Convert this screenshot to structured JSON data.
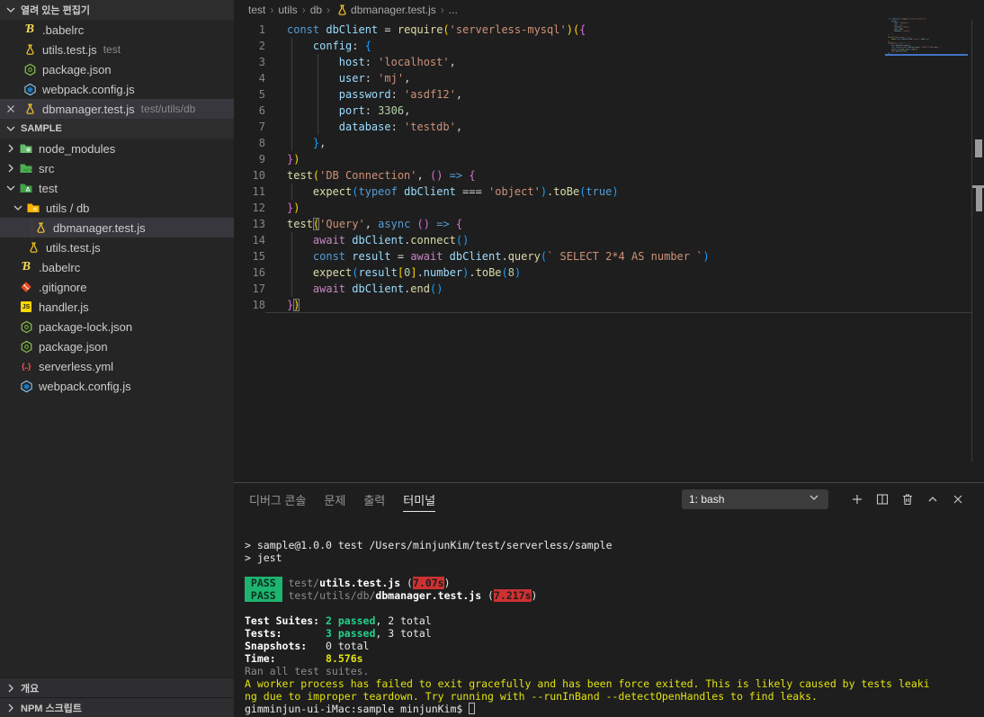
{
  "colors": {
    "accent_blue": "#3f74c4",
    "pass_badge_bg": "#1db470",
    "pass_badge_fg": "#0e2f1f",
    "time_badge_bg": "#cd3131",
    "terminal_green": "#23d18b",
    "terminal_yellow": "#e2e210",
    "selection_bg": "#37373d"
  },
  "sidebar": {
    "open_editors": {
      "header": "열려 있는 편집기",
      "items": [
        {
          "icon": "babel",
          "name": ".babelrc"
        },
        {
          "icon": "test-flask",
          "name": "utils.test.js",
          "detail": "test"
        },
        {
          "icon": "npm",
          "name": "package.json"
        },
        {
          "icon": "webpack",
          "name": "webpack.config.js"
        },
        {
          "icon": "test-flask",
          "name": "dbmanager.test.js",
          "detail": "test/utils/db",
          "selected": true,
          "close": true
        }
      ]
    },
    "explorer": {
      "header": "SAMPLE",
      "items": [
        {
          "icon": "folder-node",
          "chevron": "right",
          "name": "node_modules",
          "depth": 0
        },
        {
          "icon": "folder-src",
          "chevron": "right",
          "name": "src",
          "depth": 0
        },
        {
          "icon": "folder-test",
          "chevron": "down",
          "name": "test",
          "depth": 0
        },
        {
          "icon": "folder-utils",
          "chevron": "down",
          "name": "utils / db",
          "depth": 1
        },
        {
          "icon": "test-flask",
          "name": "dbmanager.test.js",
          "depth": 2,
          "selected": true,
          "guide": true
        },
        {
          "icon": "test-flask",
          "name": "utils.test.js",
          "depth": 1
        },
        {
          "icon": "babel",
          "name": ".babelrc",
          "depth": 0
        },
        {
          "icon": "git",
          "name": ".gitignore",
          "depth": 0
        },
        {
          "icon": "js",
          "name": "handler.js",
          "depth": 0
        },
        {
          "icon": "npm",
          "name": "package-lock.json",
          "depth": 0
        },
        {
          "icon": "npm",
          "name": "package.json",
          "depth": 0
        },
        {
          "icon": "serverless",
          "name": "serverless.yml",
          "depth": 0
        },
        {
          "icon": "webpack",
          "name": "webpack.config.js",
          "depth": 0
        }
      ]
    },
    "outline_header": "개요",
    "npm_scripts_header": "NPM 스크립트"
  },
  "editor": {
    "breadcrumb": [
      {
        "label": "test"
      },
      {
        "label": "utils"
      },
      {
        "label": "db"
      },
      {
        "label": "dbmanager.test.js",
        "icon": "test-flask"
      },
      {
        "label": "..."
      }
    ],
    "code_lines": [
      {
        "num": "1",
        "guides": [],
        "tokens": [
          [
            "kw",
            "const"
          ],
          [
            "pun",
            " "
          ],
          [
            "var",
            "dbClient"
          ],
          [
            "pun",
            " = "
          ],
          [
            "fn",
            "require"
          ],
          [
            "b1",
            "("
          ],
          [
            "str",
            "'serverless-mysql'"
          ],
          [
            "b1",
            ")"
          ],
          [
            "b1",
            "("
          ],
          [
            "b2",
            "{"
          ]
        ]
      },
      {
        "num": "2",
        "guides": [
          0
        ],
        "tokens": [
          [
            "pun",
            "    "
          ],
          [
            "var",
            "config"
          ],
          [
            "pun",
            ": "
          ],
          [
            "b3",
            "{"
          ]
        ]
      },
      {
        "num": "3",
        "guides": [
          0,
          1
        ],
        "tokens": [
          [
            "pun",
            "        "
          ],
          [
            "var",
            "host"
          ],
          [
            "pun",
            ": "
          ],
          [
            "str",
            "'localhost'"
          ],
          [
            "pun",
            ","
          ]
        ]
      },
      {
        "num": "4",
        "guides": [
          0,
          1
        ],
        "tokens": [
          [
            "pun",
            "        "
          ],
          [
            "var",
            "user"
          ],
          [
            "pun",
            ": "
          ],
          [
            "str",
            "'mj'"
          ],
          [
            "pun",
            ","
          ]
        ]
      },
      {
        "num": "5",
        "guides": [
          0,
          1
        ],
        "tokens": [
          [
            "pun",
            "        "
          ],
          [
            "var",
            "password"
          ],
          [
            "pun",
            ": "
          ],
          [
            "str",
            "'asdf12'"
          ],
          [
            "pun",
            ","
          ]
        ]
      },
      {
        "num": "6",
        "guides": [
          0,
          1
        ],
        "tokens": [
          [
            "pun",
            "        "
          ],
          [
            "var",
            "port"
          ],
          [
            "pun",
            ": "
          ],
          [
            "num",
            "3306"
          ],
          [
            "pun",
            ","
          ]
        ]
      },
      {
        "num": "7",
        "guides": [
          0,
          1
        ],
        "tokens": [
          [
            "pun",
            "        "
          ],
          [
            "var",
            "database"
          ],
          [
            "pun",
            ": "
          ],
          [
            "str",
            "'testdb'"
          ],
          [
            "pun",
            ","
          ]
        ]
      },
      {
        "num": "8",
        "guides": [
          0
        ],
        "tokens": [
          [
            "pun",
            "    "
          ],
          [
            "b3",
            "}"
          ],
          [
            "pun",
            ","
          ]
        ]
      },
      {
        "num": "9",
        "guides": [],
        "tokens": [
          [
            "b2",
            "}"
          ],
          [
            "b1",
            ")"
          ]
        ]
      },
      {
        "num": "10",
        "guides": [],
        "tokens": [
          [
            "fn",
            "test"
          ],
          [
            "b1",
            "("
          ],
          [
            "str",
            "'DB Connection'"
          ],
          [
            "pun",
            ", "
          ],
          [
            "b2",
            "("
          ],
          [
            "b2",
            ")"
          ],
          [
            "pun",
            " "
          ],
          [
            "kw",
            "=>"
          ],
          [
            "pun",
            " "
          ],
          [
            "b2",
            "{"
          ]
        ]
      },
      {
        "num": "11",
        "guides": [
          0
        ],
        "tokens": [
          [
            "pun",
            "    "
          ],
          [
            "fn",
            "expect"
          ],
          [
            "b3",
            "("
          ],
          [
            "kw",
            "typeof"
          ],
          [
            "pun",
            " "
          ],
          [
            "var",
            "dbClient"
          ],
          [
            "pun",
            " === "
          ],
          [
            "str",
            "'object'"
          ],
          [
            "b3",
            ")"
          ],
          [
            "pun",
            "."
          ],
          [
            "fn",
            "toBe"
          ],
          [
            "b3",
            "("
          ],
          [
            "kw",
            "true"
          ],
          [
            "b3",
            ")"
          ]
        ]
      },
      {
        "num": "12",
        "guides": [],
        "tokens": [
          [
            "b2",
            "}"
          ],
          [
            "b1",
            ")"
          ]
        ]
      },
      {
        "num": "13",
        "guides": [],
        "tokens": [
          [
            "fn",
            "test"
          ],
          [
            "b1",
            "(",
            true
          ],
          [
            "str",
            "'Query'"
          ],
          [
            "pun",
            ", "
          ],
          [
            "kw",
            "async"
          ],
          [
            "pun",
            " "
          ],
          [
            "b2",
            "("
          ],
          [
            "b2",
            ")"
          ],
          [
            "pun",
            " "
          ],
          [
            "kw",
            "=>"
          ],
          [
            "pun",
            " "
          ],
          [
            "b2",
            "{"
          ]
        ]
      },
      {
        "num": "14",
        "guides": [
          0
        ],
        "tokens": [
          [
            "pun",
            "    "
          ],
          [
            "ctrl",
            "await"
          ],
          [
            "pun",
            " "
          ],
          [
            "var",
            "dbClient"
          ],
          [
            "pun",
            "."
          ],
          [
            "fn",
            "connect"
          ],
          [
            "b3",
            "("
          ],
          [
            "b3",
            ")"
          ]
        ]
      },
      {
        "num": "15",
        "guides": [
          0
        ],
        "tokens": [
          [
            "pun",
            "    "
          ],
          [
            "kw",
            "const"
          ],
          [
            "pun",
            " "
          ],
          [
            "var",
            "result"
          ],
          [
            "pun",
            " = "
          ],
          [
            "ctrl",
            "await"
          ],
          [
            "pun",
            " "
          ],
          [
            "var",
            "dbClient"
          ],
          [
            "pun",
            "."
          ],
          [
            "fn",
            "query"
          ],
          [
            "b3",
            "("
          ],
          [
            "str",
            "` SELECT 2*4 AS number `"
          ],
          [
            "b3",
            ")"
          ]
        ]
      },
      {
        "num": "16",
        "guides": [
          0
        ],
        "tokens": [
          [
            "pun",
            "    "
          ],
          [
            "fn",
            "expect"
          ],
          [
            "b3",
            "("
          ],
          [
            "var",
            "result"
          ],
          [
            "b1",
            "["
          ],
          [
            "num",
            "0"
          ],
          [
            "b1",
            "]"
          ],
          [
            "pun",
            "."
          ],
          [
            "var",
            "number"
          ],
          [
            "b3",
            ")"
          ],
          [
            "pun",
            "."
          ],
          [
            "fn",
            "toBe"
          ],
          [
            "b3",
            "("
          ],
          [
            "num",
            "8"
          ],
          [
            "b3",
            ")"
          ]
        ]
      },
      {
        "num": "17",
        "guides": [
          0
        ],
        "tokens": [
          [
            "pun",
            "    "
          ],
          [
            "ctrl",
            "await"
          ],
          [
            "pun",
            " "
          ],
          [
            "var",
            "dbClient"
          ],
          [
            "pun",
            "."
          ],
          [
            "fn",
            "end"
          ],
          [
            "b3",
            "("
          ],
          [
            "b3",
            ")"
          ]
        ]
      },
      {
        "num": "18",
        "guides": [],
        "tokens": [
          [
            "b2",
            "}"
          ],
          [
            "b1",
            ")",
            true
          ]
        ]
      }
    ]
  },
  "panel": {
    "tabs": [
      {
        "label": "디버그 콘솔"
      },
      {
        "label": "문제"
      },
      {
        "label": "출력"
      },
      {
        "label": "터미널",
        "active": true
      }
    ],
    "shell_select": "1: bash",
    "actions": [
      "new-terminal",
      "split-terminal",
      "kill-terminal",
      "maximize-panel",
      "close-panel"
    ],
    "terminal_lines": [
      [
        [
          "",
          "> sample@1.0.0 test /Users/minjunKim/test/serverless/sample"
        ]
      ],
      [
        [
          "",
          "> jest"
        ]
      ],
      [],
      [
        [
          "pass",
          " PASS "
        ],
        [
          "",
          " "
        ],
        [
          "dim",
          "test/"
        ],
        [
          "bold",
          "utils.test.js"
        ],
        [
          "",
          " ("
        ],
        [
          "time",
          "7.07s"
        ],
        [
          "",
          ")"
        ]
      ],
      [
        [
          "pass",
          " PASS "
        ],
        [
          "",
          " "
        ],
        [
          "dim",
          "test/utils/db/"
        ],
        [
          "bold",
          "dbmanager.test.js"
        ],
        [
          "",
          " ("
        ],
        [
          "time",
          "7.217s"
        ],
        [
          "",
          ")"
        ]
      ],
      [],
      [
        [
          "bold",
          "Test Suites: "
        ],
        [
          "greenb",
          "2 passed"
        ],
        [
          "",
          ", 2 total"
        ]
      ],
      [
        [
          "bold",
          "Tests:       "
        ],
        [
          "greenb",
          "3 passed"
        ],
        [
          "",
          ", 3 total"
        ]
      ],
      [
        [
          "bold",
          "Snapshots:   "
        ],
        [
          "",
          "0 total"
        ]
      ],
      [
        [
          "bold",
          "Time:        "
        ],
        [
          "yellowb",
          "8.576s"
        ]
      ],
      [
        [
          "dim",
          "Ran all test suites."
        ]
      ],
      [
        [
          "yellow",
          "A worker process has failed to exit gracefully and has been force exited. This is likely caused by tests leaki"
        ]
      ],
      [
        [
          "yellow",
          "ng due to improper teardown. Try running with --runInBand --detectOpenHandles to find leaks."
        ]
      ],
      [
        [
          "",
          "gimminjun-ui-iMac:sample minjunKim$ "
        ],
        [
          "cursor",
          " "
        ]
      ]
    ]
  }
}
